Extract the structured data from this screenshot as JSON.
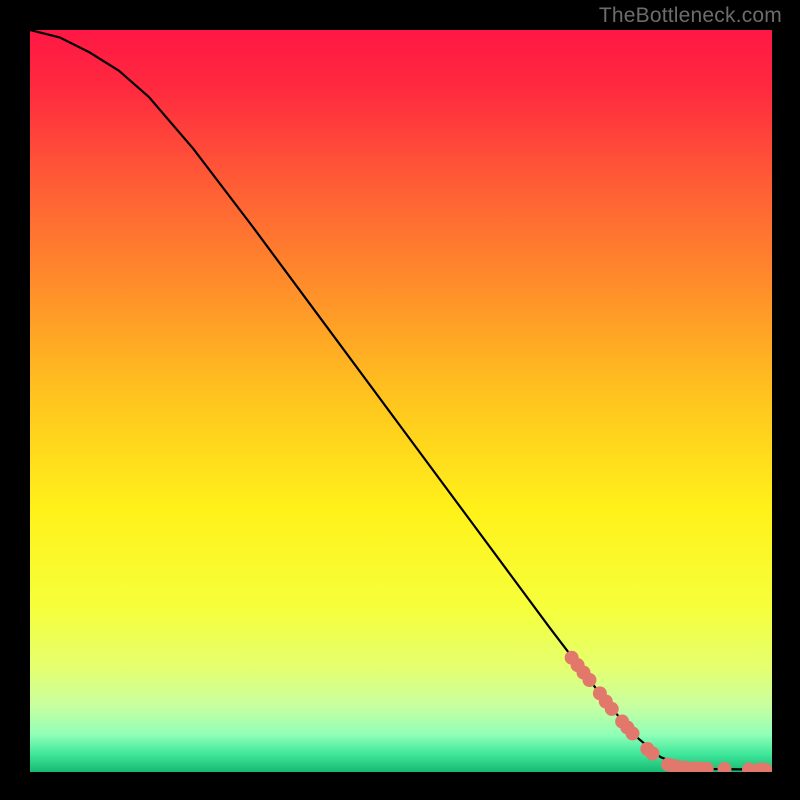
{
  "attribution": "TheBottleneck.com",
  "chart_data": {
    "type": "line",
    "title": "",
    "xlabel": "",
    "ylabel": "",
    "xlim": [
      0,
      100
    ],
    "ylim": [
      0,
      100
    ],
    "curve": [
      {
        "x": 0,
        "y": 100
      },
      {
        "x": 4,
        "y": 99
      },
      {
        "x": 8,
        "y": 97
      },
      {
        "x": 12,
        "y": 94.5
      },
      {
        "x": 16,
        "y": 91
      },
      {
        "x": 22,
        "y": 84
      },
      {
        "x": 30,
        "y": 73.5
      },
      {
        "x": 40,
        "y": 60
      },
      {
        "x": 50,
        "y": 46.5
      },
      {
        "x": 60,
        "y": 33
      },
      {
        "x": 70,
        "y": 19.5
      },
      {
        "x": 78,
        "y": 9
      },
      {
        "x": 82,
        "y": 4.5
      },
      {
        "x": 85,
        "y": 2
      },
      {
        "x": 88,
        "y": 0.8
      },
      {
        "x": 92,
        "y": 0.4
      },
      {
        "x": 100,
        "y": 0.3
      }
    ],
    "markers": [
      {
        "x": 73.0,
        "y": 15.4
      },
      {
        "x": 73.8,
        "y": 14.4
      },
      {
        "x": 74.6,
        "y": 13.4
      },
      {
        "x": 75.4,
        "y": 12.4
      },
      {
        "x": 76.8,
        "y": 10.6
      },
      {
        "x": 77.6,
        "y": 9.5
      },
      {
        "x": 78.4,
        "y": 8.5
      },
      {
        "x": 79.8,
        "y": 6.8
      },
      {
        "x": 80.5,
        "y": 6.0
      },
      {
        "x": 81.2,
        "y": 5.2
      },
      {
        "x": 83.2,
        "y": 3.1
      },
      {
        "x": 83.9,
        "y": 2.5
      },
      {
        "x": 86.0,
        "y": 1.0
      },
      {
        "x": 86.8,
        "y": 0.8
      },
      {
        "x": 87.6,
        "y": 0.6
      },
      {
        "x": 88.4,
        "y": 0.55
      },
      {
        "x": 89.6,
        "y": 0.5
      },
      {
        "x": 90.4,
        "y": 0.46
      },
      {
        "x": 91.2,
        "y": 0.44
      },
      {
        "x": 93.6,
        "y": 0.4
      },
      {
        "x": 96.9,
        "y": 0.33
      },
      {
        "x": 98.3,
        "y": 0.32
      },
      {
        "x": 99.1,
        "y": 0.31
      }
    ],
    "marker_color": "#e2786b",
    "marker_radius_px": 7,
    "gradient_stops": [
      {
        "offset": 0.0,
        "color": "#ff1744"
      },
      {
        "offset": 0.08,
        "color": "#ff2a3f"
      },
      {
        "offset": 0.2,
        "color": "#ff5a36"
      },
      {
        "offset": 0.35,
        "color": "#ff8f2a"
      },
      {
        "offset": 0.5,
        "color": "#ffc61e"
      },
      {
        "offset": 0.65,
        "color": "#fff21a"
      },
      {
        "offset": 0.78,
        "color": "#f6ff3c"
      },
      {
        "offset": 0.86,
        "color": "#e4ff70"
      },
      {
        "offset": 0.91,
        "color": "#c9ffa0"
      },
      {
        "offset": 0.95,
        "color": "#8fffb8"
      },
      {
        "offset": 0.975,
        "color": "#42e89b"
      },
      {
        "offset": 1.0,
        "color": "#16b971"
      }
    ]
  }
}
